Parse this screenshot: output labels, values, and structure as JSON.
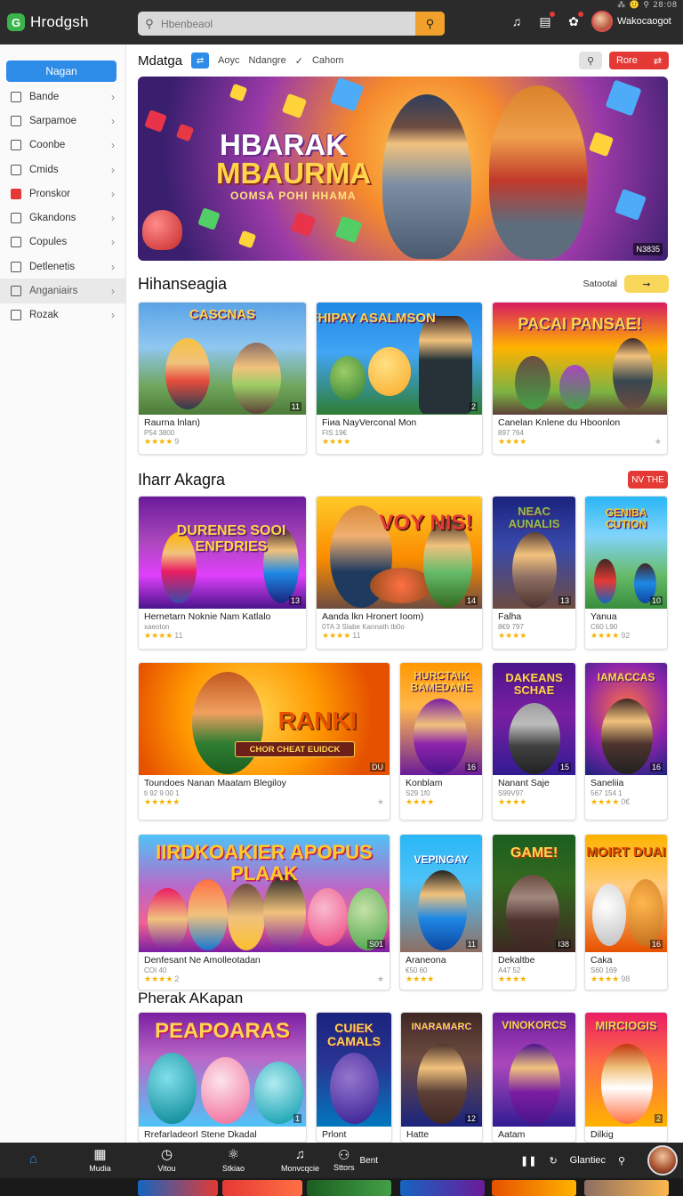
{
  "app": {
    "name": "Hrodgsh",
    "status": "⁂ 🙂 ⚲ 28:08"
  },
  "search": {
    "placeholder": "Hbenbeaol"
  },
  "user": {
    "name": "Wakocaogot"
  },
  "sidebar": {
    "new_button": "Nagan",
    "items": [
      {
        "label": "Bande",
        "icon": "home-icon"
      },
      {
        "label": "Sarpamoe",
        "icon": "chart-icon"
      },
      {
        "label": "Coonbe",
        "icon": "grid-icon"
      },
      {
        "label": "Cmids",
        "icon": "star-icon"
      },
      {
        "label": "Pronskor",
        "icon": "bookmark-icon"
      },
      {
        "label": "Gkandons",
        "icon": "folder-icon"
      },
      {
        "label": "Copules",
        "icon": "users-icon"
      },
      {
        "label": "Detlenetis",
        "icon": "list-icon"
      },
      {
        "label": "Anganiairs",
        "icon": "box-icon"
      },
      {
        "label": "Rozak",
        "icon": "tag-icon"
      }
    ]
  },
  "filterbar": {
    "title": "Mdatga",
    "tabs": [
      "Aoyc",
      "Ndangre",
      "Cahom"
    ],
    "red_button": "Rore"
  },
  "hero": {
    "line1": "HBARAK",
    "line2": "MBAURMA",
    "subtitle": "OOMSA POHI HHAMA",
    "badge": "N3835"
  },
  "section1": {
    "title": "Hihanseagia",
    "action": "Satootal",
    "cards": [
      {
        "thumb": "CASCNAS",
        "title": "Raurna lnlan)",
        "sub": "P54 3800",
        "stars": "★★★★",
        "num": "11",
        "count": "9"
      },
      {
        "thumb": "FHIPAY ASALMSON",
        "title": "Fiиa NayVerconal Mon",
        "sub": "FIS 19€",
        "stars": "★★★★",
        "num": "2",
        "count": ""
      },
      {
        "thumb": "PACAI PANSAE!",
        "title": "Canelan Knlene du Hboonlon",
        "sub": "897 764",
        "stars": "★★★★",
        "num": "",
        "count": ""
      }
    ]
  },
  "section2": {
    "title": "Iharr Akagra",
    "action": "NV THE",
    "row1": [
      {
        "thumb": "DURENES SOOI ENFDRIES",
        "title": "Hernetarn Noknie Nam Katlalo",
        "sub": "xaeoton",
        "stars": "★★★★",
        "count": "11",
        "num": "13"
      },
      {
        "thumb": "VOY NIS!",
        "title": "Aanda lkn Hronert Ioom)",
        "sub": "0TA 3 Slabe Kannath tb0o",
        "stars": "★★★★",
        "count": "11",
        "num": "14"
      },
      {
        "thumb": "NEAC AUNALIS",
        "title": "Falha",
        "sub": "8€9 797",
        "stars": "★★★★",
        "count": "",
        "num": "13"
      },
      {
        "thumb": "GENIBA CUTION",
        "title": "Yanua",
        "sub": "C60 L90",
        "stars": "★★★★",
        "count": "92",
        "num": "10"
      }
    ],
    "row2": [
      {
        "thumb": "RANKI",
        "banner": "CHOR CHEAT EUIDCK",
        "title": "Toundoes  Nanan Maatam Blegiloy",
        "sub": "ti 92 9 00 1",
        "stars": "★★★★★",
        "count": "",
        "num": "DU"
      },
      {
        "thumb": "HURCTAIK BAMEDANE",
        "title": "Konblam",
        "sub": "S29 1f0",
        "stars": "★★★★",
        "count": "",
        "num": "16"
      },
      {
        "thumb": "DAKEANS SCHAE",
        "title": "Nanant Saje",
        "sub": "S99V97",
        "stars": "★★★★",
        "count": "",
        "num": "15"
      },
      {
        "thumb": "IAMACCAS",
        "title": "Saneliia",
        "sub": "567 154 1",
        "stars": "★★★★",
        "count": "0€",
        "num": "16"
      }
    ],
    "row3": [
      {
        "thumb": "IIRDKOAKIER APOPUS PLAAK",
        "title": "Denfesant Ne Amolleotadan",
        "sub": "COI 40",
        "stars": "★★★★",
        "count": "2",
        "num": "S01"
      },
      {
        "thumb": "VEPINGAY",
        "title": "Araneona",
        "sub": "€50 60",
        "stars": "★★★★",
        "count": "",
        "num": "11"
      },
      {
        "thumb": "GAME!",
        "title": "Dekaltbe",
        "sub": "A47 52",
        "stars": "★★★★",
        "count": "",
        "num": "I38"
      },
      {
        "thumb": "MOIRT DUAI",
        "title": "Caka",
        "sub": "S60 169",
        "stars": "★★★★",
        "count": "98",
        "num": "16"
      }
    ]
  },
  "section3": {
    "title": "Pherak AKapan",
    "row": [
      {
        "thumb": "PEAPOARAS",
        "title": "Rrefarladeorl Stene Dkadal",
        "num": "1"
      },
      {
        "thumb": "CUIEK CAMALS",
        "title": "Prlont",
        "num": ""
      },
      {
        "thumb": "INARAMARC",
        "title": "Hatte",
        "num": "12"
      },
      {
        "thumb": "VINOKORCS",
        "title": "Aatam",
        "num": ""
      },
      {
        "thumb": "MIRCIOGIS",
        "title": "Dilkig",
        "num": "2"
      }
    ]
  },
  "bottombar": {
    "items": [
      {
        "label": "",
        "icon": "home-icon"
      },
      {
        "label": "Mudia",
        "icon": "calendar-icon"
      },
      {
        "label": "Vitou",
        "icon": "clock-icon"
      },
      {
        "label": "Stkiao",
        "icon": "puzzle-icon"
      },
      {
        "label": "Monvcqcie",
        "icon": "doc-icon"
      },
      {
        "label": "Sttors",
        "icon": "people-icon"
      }
    ],
    "bent_label": "Bent",
    "right_label": "Glantiec"
  },
  "colors": {
    "accent": "#2d8ce8",
    "red": "#e53935",
    "yellow": "#f7d65a",
    "topbar": "#2b2b2b"
  }
}
